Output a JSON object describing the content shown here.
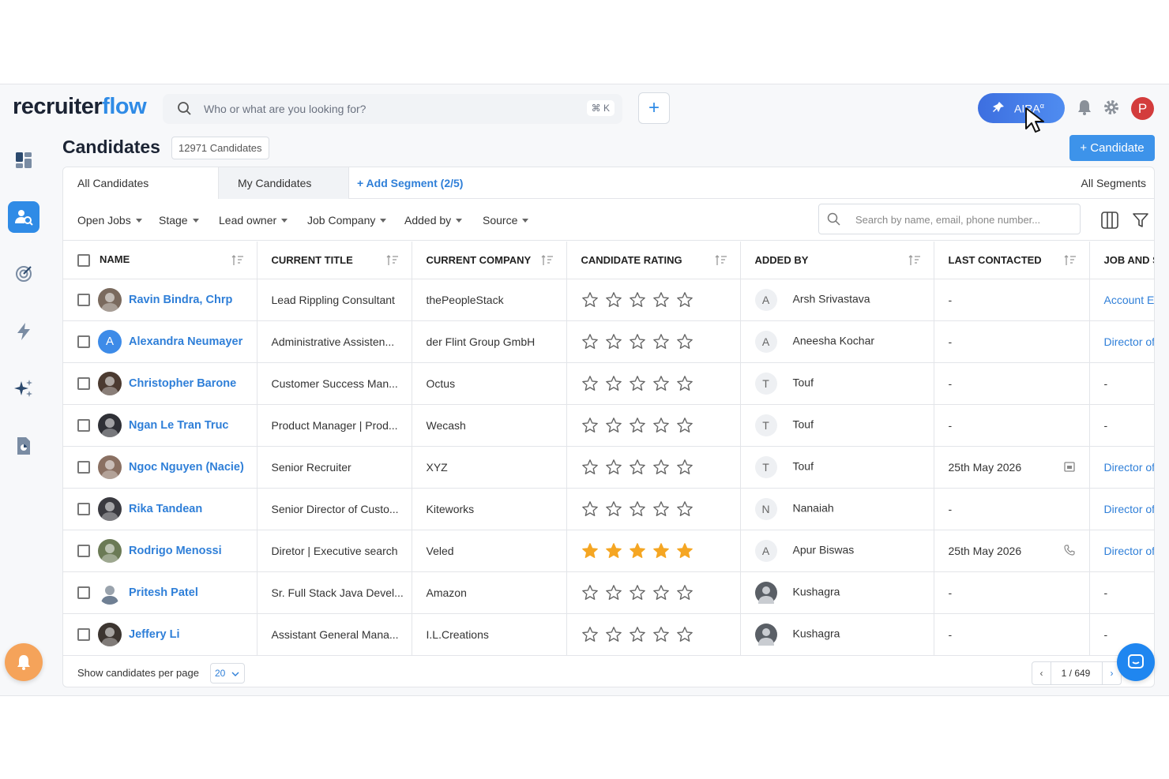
{
  "app": {
    "logo_part1": "recruiter",
    "logo_part2": "flow"
  },
  "search": {
    "placeholder": "Who or what are you looking for?",
    "shortcut": "⌘ K"
  },
  "topbar": {
    "new_label": "+",
    "aira_label": "AIRA",
    "aira_superscript": "α",
    "user_initial": "P"
  },
  "page": {
    "title": "Candidates",
    "count": "12971 Candidates",
    "add_button": "+ Candidate"
  },
  "tabs": {
    "all": "All Candidates",
    "mine": "My Candidates",
    "add_segment": "+ Add Segment (2/5)",
    "all_segments": "All Segments"
  },
  "filters": [
    "Open Jobs",
    "Stage",
    "Lead owner",
    "Job Company",
    "Added by",
    "Source"
  ],
  "table_search": {
    "placeholder": "Search by name, email, phone number..."
  },
  "columns": [
    "NAME",
    "CURRENT TITLE",
    "CURRENT COMPANY",
    "CANDIDATE RATING",
    "ADDED BY",
    "LAST CONTACTED",
    "JOB AND S"
  ],
  "rows": [
    {
      "name": "Ravin Bindra, Chrp",
      "title": "Lead Rippling Consultant",
      "company": "thePeopleStack",
      "rating": 0,
      "added_initial": "A",
      "added_by": "Arsh Srivastava",
      "last_contacted": "-",
      "job": "Account E",
      "avatar_color": "#7a6a5e",
      "avatar_text": ""
    },
    {
      "name": "Alexandra Neumayer",
      "title": "Administrative Assisten...",
      "company": "der Flint Group GmbH",
      "rating": 0,
      "added_initial": "A",
      "added_by": "Aneesha Kochar",
      "last_contacted": "-",
      "job": "Director of",
      "avatar_color": "#3d8be8",
      "avatar_text": "A"
    },
    {
      "name": "Christopher Barone",
      "title": "Customer Success Man...",
      "company": "Octus",
      "rating": 0,
      "added_initial": "T",
      "added_by": "Touf",
      "last_contacted": "-",
      "job": "-",
      "avatar_color": "#4b3a30",
      "avatar_text": ""
    },
    {
      "name": "Ngan Le Tran Truc",
      "title": "Product Manager | Prod...",
      "company": "Wecash",
      "rating": 0,
      "added_initial": "T",
      "added_by": "Touf",
      "last_contacted": "-",
      "job": "-",
      "avatar_color": "#2f3036",
      "avatar_text": ""
    },
    {
      "name": "Ngoc Nguyen (Nacie)",
      "title": "Senior Recruiter",
      "company": "XYZ",
      "rating": 0,
      "added_initial": "T",
      "added_by": "Touf",
      "last_contacted": "25th May 2026",
      "job": "Director of",
      "avatar_color": "#8a7062",
      "avatar_text": "",
      "contact_icon": "calendar-icon"
    },
    {
      "name": "Rika Tandean",
      "title": "Senior Director of Custo...",
      "company": "Kiteworks",
      "rating": 0,
      "added_initial": "N",
      "added_by": "Nanaiah",
      "last_contacted": "-",
      "job": "Director of",
      "avatar_color": "#3a3a40",
      "avatar_text": ""
    },
    {
      "name": "Rodrigo Menossi",
      "title": "Diretor | Executive search",
      "company": "Veled",
      "rating": 5,
      "added_initial": "A",
      "added_by": "Apur Biswas",
      "last_contacted": "25th May 2026",
      "job": "Director of",
      "avatar_color": "#6b7a55",
      "avatar_text": "",
      "contact_icon": "phone-icon"
    },
    {
      "name": "Pritesh Patel",
      "title": "Sr. Full Stack Java Devel...",
      "company": "Amazon",
      "rating": 0,
      "added_initial": "",
      "added_by": "Kushagra",
      "last_contacted": "-",
      "job": "-",
      "avatar_color": "#ffffff",
      "avatar_text": "",
      "added_photo": true
    },
    {
      "name": "Jeffery Li",
      "title": "Assistant General Mana...",
      "company": "I.L.Creations",
      "rating": 0,
      "added_initial": "",
      "added_by": "Kushagra",
      "last_contacted": "-",
      "job": "-",
      "avatar_color": "#3c3530",
      "avatar_text": "",
      "added_photo": true
    }
  ],
  "footer": {
    "per_page_label": "Show candidates per page",
    "per_page_value": "20",
    "page": "1 / 649",
    "prev": "‹",
    "next": "›"
  },
  "colors": {
    "accent": "#2f8be6",
    "link": "#2f7fd8",
    "star_filled": "#f5a623",
    "star_empty": "#666666"
  }
}
